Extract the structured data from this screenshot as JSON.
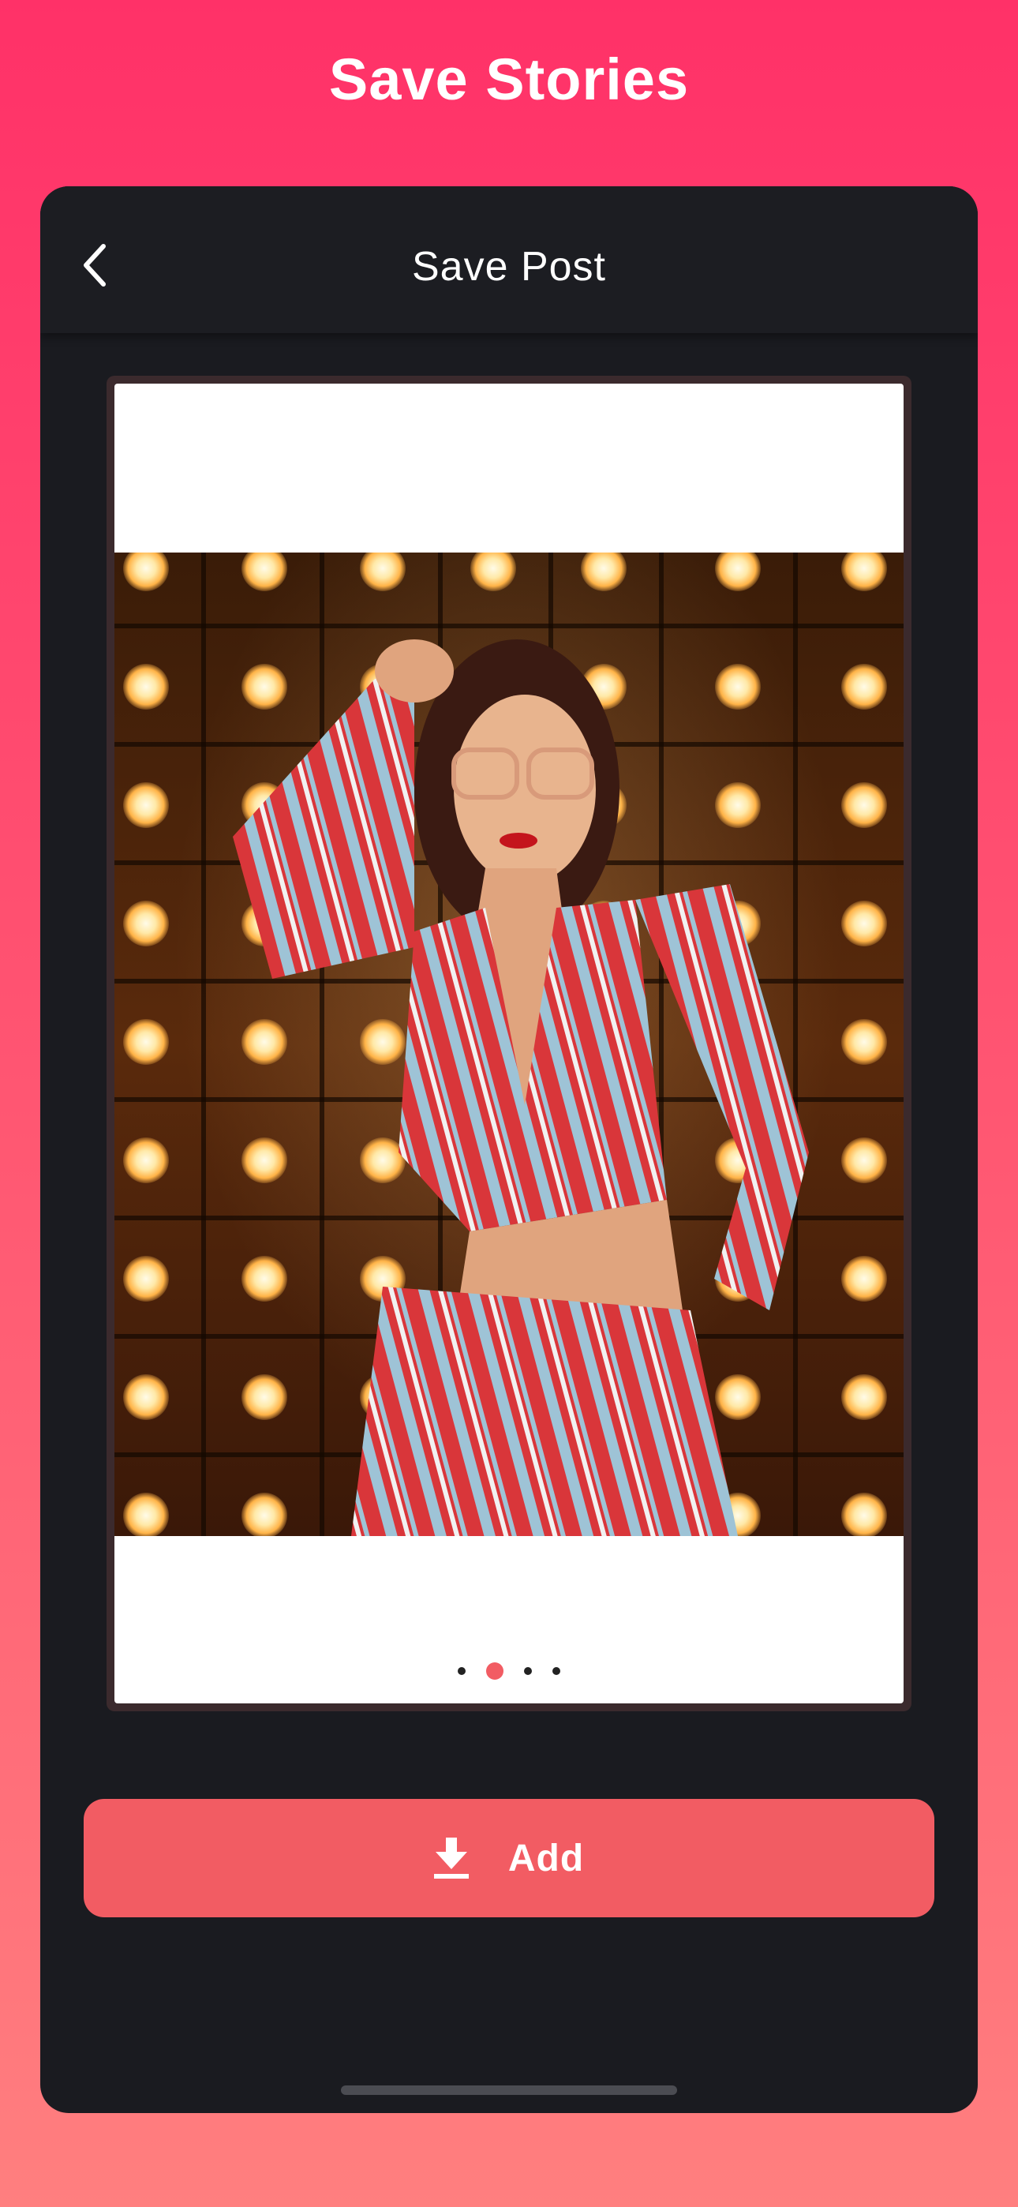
{
  "header": {
    "title": "Save Stories"
  },
  "nav": {
    "title": "Save Post",
    "back_icon": "chevron-left-icon"
  },
  "post": {
    "image_description_icon": "photo",
    "carousel": {
      "count": 4,
      "active_index": 1
    }
  },
  "actions": {
    "add_label": "Add",
    "add_icon": "download-icon"
  },
  "colors": {
    "background_top": "#ff3168",
    "background_bottom": "#ff7f7f",
    "card": "#1a1b20",
    "accent": "#f25c63"
  }
}
